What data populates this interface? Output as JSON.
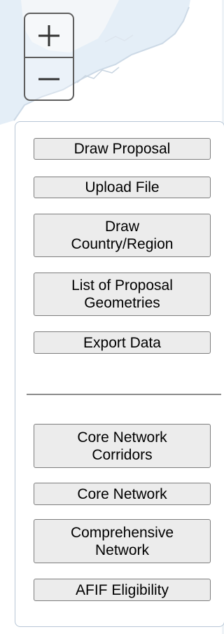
{
  "zoom": {
    "in_icon": "plus-icon",
    "out_icon": "minus-icon"
  },
  "panel": {
    "tools": [
      {
        "label": "Draw Proposal"
      },
      {
        "label": "Upload File"
      },
      {
        "label": "Draw\nCountry/Region"
      },
      {
        "label": "List of Proposal\nGeometries"
      },
      {
        "label": "Export Data"
      }
    ],
    "layers": [
      {
        "label": "Core Network\nCorridors"
      },
      {
        "label": "Core Network"
      },
      {
        "label": "Comprehensive\nNetwork"
      },
      {
        "label": "AFIF Eligibility"
      }
    ]
  },
  "colors": {
    "button_bg": "#ececec",
    "button_border": "#7d7d7d",
    "panel_border": "#b7c6d6",
    "map_land": "#ffffff",
    "map_water": "#dde9f4"
  }
}
